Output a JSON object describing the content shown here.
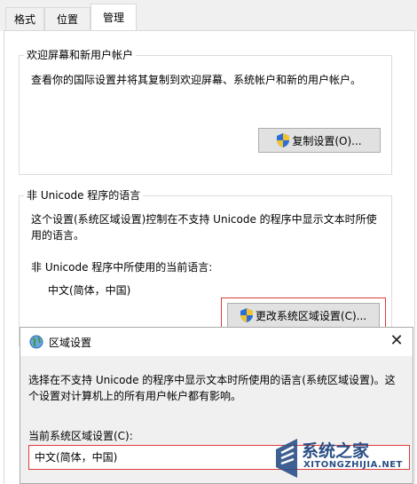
{
  "tabs": [
    {
      "label": "格式"
    },
    {
      "label": "位置"
    },
    {
      "label": "管理"
    }
  ],
  "welcome_group": {
    "title": "欢迎屏幕和新用户帐户",
    "description": "查看你的国际设置并将其复制到欢迎屏幕、系统帐户和新的用户帐户。",
    "copy_button": "复制设置(O)..."
  },
  "unicode_group": {
    "title": "非 Unicode 程序的语言",
    "description_line1": "这个设置(系统区域设置)控制在不支持 Unicode 的程序中显示文本时所使",
    "description_line2": "用的语言。",
    "current_label": "非 Unicode 程序中所使用的当前语言:",
    "current_value": "中文(简体，中国)",
    "change_button": "更改系统区域设置(C)..."
  },
  "dialog": {
    "title": "区域设置",
    "close_glyph": "✕",
    "description_line1": "选择在不支持 Unicode 的程序中显示文本时所使用的语言(系统区域设置)。这",
    "description_line2": "个设置对计算机上的所有用户帐户都有影响。",
    "current_label": "当前系统区域设置(C):",
    "current_value": "中文(简体，中国)"
  },
  "watermark": {
    "text": "系统之家",
    "url": "XITONGZHIJIA.NET"
  },
  "colors": {
    "highlight_border": "#e03a3a",
    "shield_blue": "#2b6fd6",
    "shield_yellow": "#f2c230",
    "watermark_blue": "#2a4f86"
  }
}
